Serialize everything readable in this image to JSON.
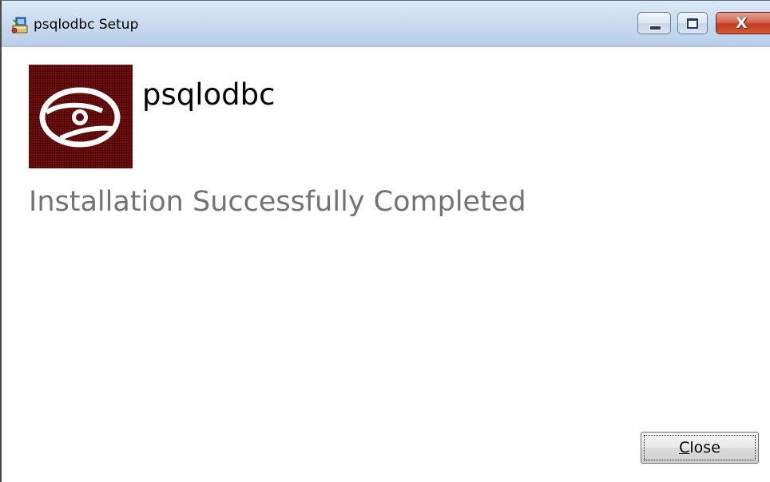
{
  "window": {
    "title": "psqlodbc Setup",
    "icon": "installer-icon"
  },
  "caption_buttons": {
    "minimize_icon": "minimize-icon",
    "maximize_icon": "maximize-icon",
    "close_icon": "close-icon",
    "close_glyph": "X"
  },
  "header": {
    "product_name": "psqlodbc",
    "logo_icon": "disc-icon",
    "logo_color": "#5a0a0a"
  },
  "main": {
    "status": "Installation Successfully Completed",
    "status_color": "#737373"
  },
  "footer": {
    "close_mnemonic": "C",
    "close_rest": "lose"
  }
}
